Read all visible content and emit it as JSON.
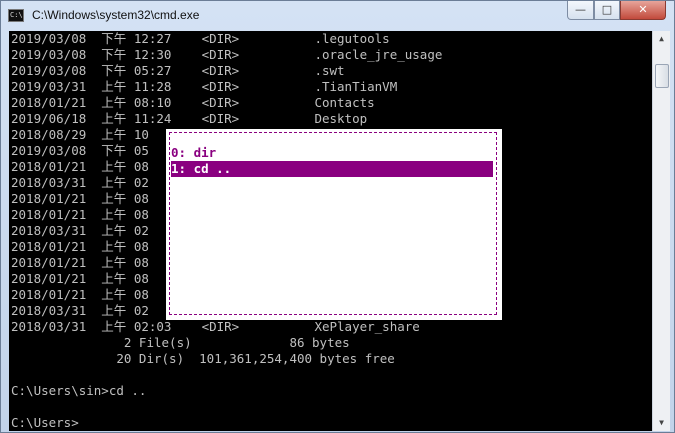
{
  "window": {
    "title": "C:\\Windows\\system32\\cmd.exe",
    "icon": "console-icon",
    "controls": {
      "minimize": "—",
      "maximize": "□",
      "close": "✕"
    }
  },
  "console": {
    "lines": [
      "2019/03/08  下午 12:27    <DIR>          .legutools",
      "2019/03/08  下午 12:30    <DIR>          .oracle_jre_usage",
      "2019/03/08  下午 05:27    <DIR>          .swt",
      "2019/03/31  上午 11:28    <DIR>          .TianTianVM",
      "2018/01/21  上午 08:10    <DIR>          Contacts",
      "2019/06/18  上午 11:24    <DIR>          Desktop",
      "2018/08/29  上午 10",
      "2019/03/08  下午 05",
      "2018/01/21  上午 08",
      "2018/03/31  上午 02",
      "2018/01/21  上午 08",
      "2018/01/21  上午 08",
      "2018/03/31  上午 02",
      "2018/01/21  上午 08",
      "2018/01/21  上午 08",
      "2018/01/21  上午 08",
      "2018/01/21  上午 08",
      "2018/03/31  上午 02",
      "2018/03/31  上午 02:03    <DIR>          XePlayer_share",
      "               2 File(s)             86 bytes",
      "              20 Dir(s)  101,361,254,400 bytes free",
      "",
      "C:\\Users\\sin>cd ..",
      "",
      "C:\\Users>"
    ]
  },
  "popup": {
    "items": [
      {
        "label": "0: dir"
      },
      {
        "label": "1: cd .."
      }
    ],
    "selected_index": 1
  },
  "scrollbar": {
    "up_arrow": "▲",
    "down_arrow": "▼"
  },
  "colors": {
    "console_bg": "#000000",
    "console_text": "#c0c0c0",
    "popup_accent": "#8a0080",
    "popup_bg": "#ffffff"
  }
}
